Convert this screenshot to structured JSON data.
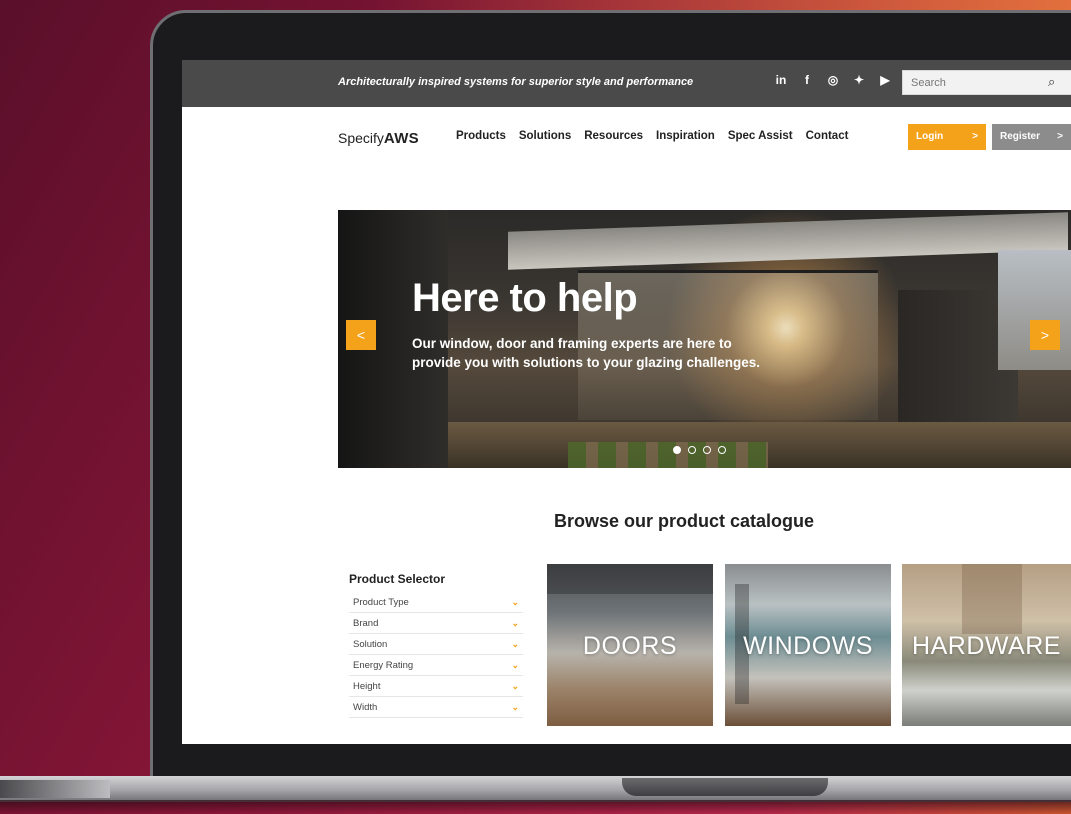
{
  "colors": {
    "accent": "#f5a21b",
    "topbar": "#4a4a4a",
    "register_bg": "#8c8c8c"
  },
  "topbar": {
    "tagline": "Architecturally inspired systems for superior style and performance",
    "socials": [
      "in",
      "f",
      "◎",
      "✦",
      "▶"
    ],
    "search_placeholder": "Search",
    "search_icon": "search-icon"
  },
  "header": {
    "logo_prefix": "Specify",
    "logo_brand": "AWS",
    "nav": [
      "Products",
      "Solutions",
      "Resources",
      "Inspiration",
      "Spec Assist",
      "Contact"
    ],
    "login_label": "Login",
    "register_label": "Register"
  },
  "hero": {
    "title": "Here to help",
    "text": "Our window, door and framing experts are here to provide you with solutions to your glazing challenges.",
    "prev_icon": "chevron-left-icon",
    "next_icon": "chevron-right-icon",
    "slides_count": 4,
    "active_slide": 1
  },
  "catalogue": {
    "title": "Browse our product catalogue",
    "selector_title": "Product Selector",
    "filters": [
      "Product Type",
      "Brand",
      "Solution",
      "Energy Rating",
      "Height",
      "Width"
    ],
    "tiles": [
      "DOORS",
      "WINDOWS",
      "HARDWARE"
    ]
  }
}
